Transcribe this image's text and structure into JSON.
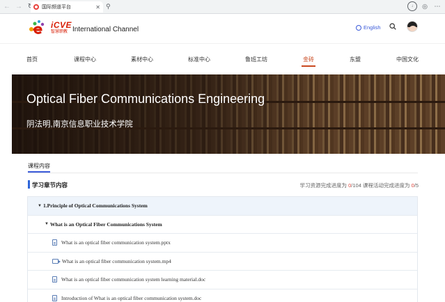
{
  "browser": {
    "tab_title": "国际频道平台",
    "back_icon": "back-arrow-icon",
    "forward_icon": "forward-arrow-icon",
    "reload_icon": "reload-icon",
    "close_glyph": "✕"
  },
  "header": {
    "logo_text": "iCVE",
    "logo_sub": "智慧职教",
    "channel_name": "International Channel",
    "language": "English"
  },
  "nav": {
    "items": [
      {
        "label": "首页"
      },
      {
        "label": "课程中心"
      },
      {
        "label": "素材中心"
      },
      {
        "label": "标准中心"
      },
      {
        "label": "鲁班工坊"
      },
      {
        "label": "金砖"
      },
      {
        "label": "东盟"
      },
      {
        "label": "中国文化"
      }
    ],
    "active_index": 5
  },
  "banner": {
    "title": "Optical Fiber Communications Engineering",
    "subtitle": "阴法明,南京信息职业技术学院"
  },
  "content": {
    "tab_label": "课程内容",
    "section_title": "学习章节内容",
    "progress": {
      "resource_prefix": "学习资源完成进度为 ",
      "resource_done": "0",
      "resource_total": "/104",
      "activity_prefix": " 课程活动完成进度为 ",
      "activity_done": "0",
      "activity_total": "/5"
    },
    "tree": [
      {
        "kind": "chapter",
        "label": "1.Principle of Optical Communications System"
      },
      {
        "kind": "section",
        "label": "What is an Optical Fiber Communications System"
      },
      {
        "kind": "doc",
        "label": "What is an optical fiber communication system.pptx"
      },
      {
        "kind": "video",
        "label": "What is an optical fiber communication system.mp4"
      },
      {
        "kind": "doc",
        "label": "What is an optical fiber communication system learning material.doc"
      },
      {
        "kind": "doc",
        "label": "Introduction of What is an optical fiber communication system.doc"
      }
    ]
  },
  "colors": {
    "accent_active": "#c9481f",
    "link_blue": "#3a5ad9",
    "progress_red": "#e0453a",
    "chapter_bg": "#eef4fb"
  }
}
